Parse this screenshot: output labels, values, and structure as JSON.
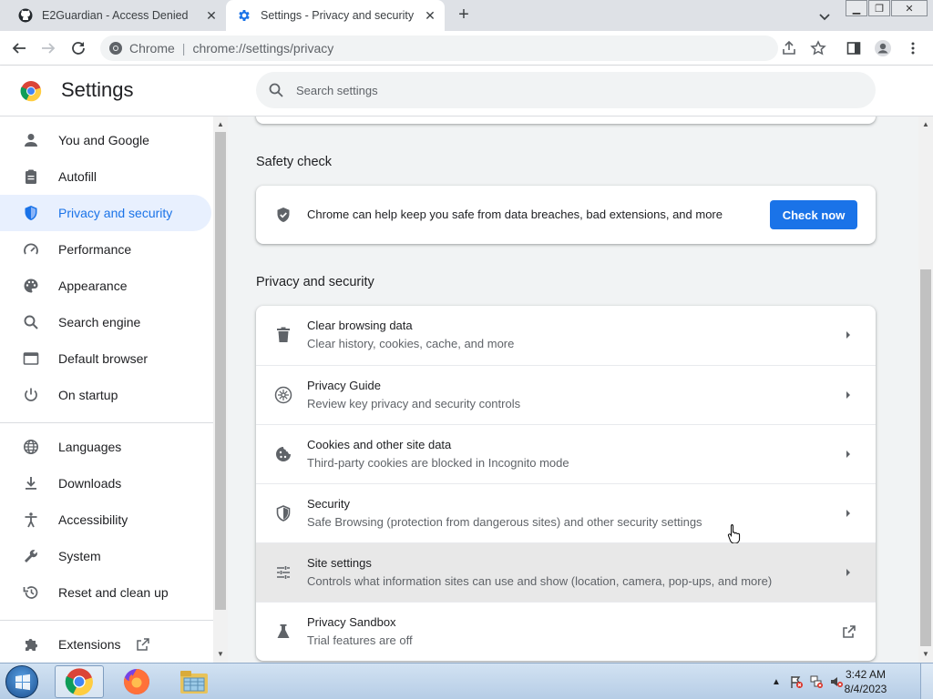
{
  "tabs": [
    {
      "title": "E2Guardian - Access Denied",
      "icon": "github-icon"
    },
    {
      "title": "Settings - Privacy and security",
      "icon": "gear-icon",
      "active": true
    }
  ],
  "toolbar": {
    "site_name": "Chrome",
    "url": "chrome://settings/privacy"
  },
  "settings": {
    "title": "Settings",
    "search_placeholder": "Search settings"
  },
  "sidebar": {
    "items": [
      {
        "label": "You and Google",
        "icon": "person-icon"
      },
      {
        "label": "Autofill",
        "icon": "clipboard-icon"
      },
      {
        "label": "Privacy and security",
        "icon": "shield-icon",
        "active": true
      },
      {
        "label": "Performance",
        "icon": "gauge-icon"
      },
      {
        "label": "Appearance",
        "icon": "palette-icon"
      },
      {
        "label": "Search engine",
        "icon": "search-icon"
      },
      {
        "label": "Default browser",
        "icon": "browser-icon"
      },
      {
        "label": "On startup",
        "icon": "power-icon"
      },
      {
        "label": "Languages",
        "icon": "globe-icon"
      },
      {
        "label": "Downloads",
        "icon": "download-icon"
      },
      {
        "label": "Accessibility",
        "icon": "accessibility-icon"
      },
      {
        "label": "System",
        "icon": "wrench-icon"
      },
      {
        "label": "Reset and clean up",
        "icon": "history-icon"
      },
      {
        "label": "Extensions",
        "icon": "puzzle-icon"
      }
    ]
  },
  "safety_check": {
    "title": "Safety check",
    "text": "Chrome can help keep you safe from data breaches, bad extensions, and more",
    "button": "Check now"
  },
  "privacy": {
    "title": "Privacy and security",
    "rows": [
      {
        "title": "Clear browsing data",
        "subtitle": "Clear history, cookies, cache, and more",
        "icon": "trash-icon"
      },
      {
        "title": "Privacy Guide",
        "subtitle": "Review key privacy and security controls",
        "icon": "privacy-guide-icon"
      },
      {
        "title": "Cookies and other site data",
        "subtitle": "Third-party cookies are blocked in Incognito mode",
        "icon": "cookie-icon"
      },
      {
        "title": "Security",
        "subtitle": "Safe Browsing (protection from dangerous sites) and other security settings",
        "icon": "security-shield-icon"
      },
      {
        "title": "Site settings",
        "subtitle": "Controls what information sites can use and show (location, camera, pop-ups, and more)",
        "icon": "tune-icon"
      },
      {
        "title": "Privacy Sandbox",
        "subtitle": "Trial features are off",
        "icon": "flask-icon"
      }
    ]
  },
  "taskbar": {
    "time": "3:42 AM",
    "date": "8/4/2023"
  },
  "colors": {
    "accent": "#1a73e8",
    "active_nav_bg": "#e8f0fe"
  }
}
